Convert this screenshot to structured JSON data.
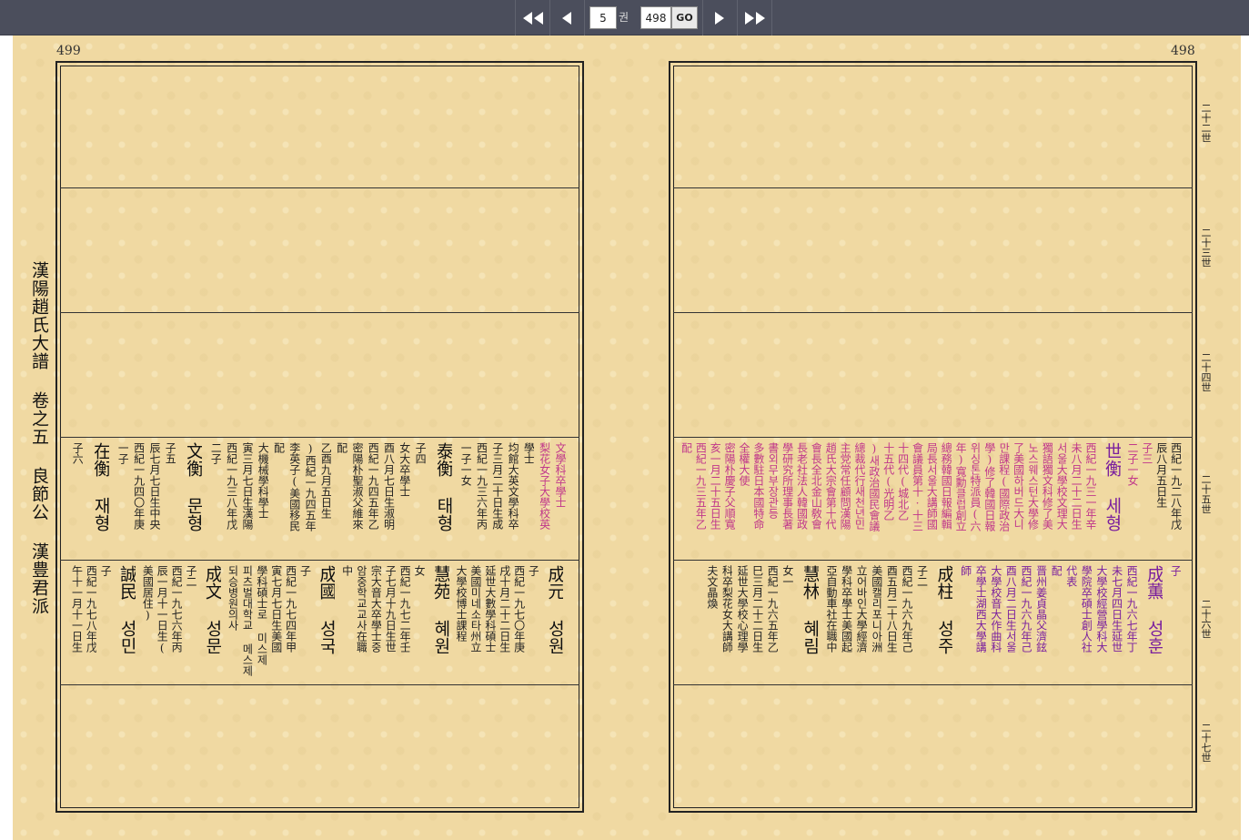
{
  "toolbar": {
    "volume": "5",
    "volume_unit": "권",
    "page": "498",
    "go_label": "GO"
  },
  "pages": {
    "left_number": "499",
    "right_number": "498"
  },
  "side_title": "漢陽趙氏大譜 卷之五 良節公 漢豊君派",
  "generations": [
    "二十二世",
    "二十三世",
    "二十四世",
    "二十五世",
    "二十六世",
    "二十七世"
  ],
  "left_gen25": [
    {
      "t": "子六",
      "c": "#222"
    },
    {
      "t": "在衡 재형",
      "c": "#111",
      "big": true
    },
    {
      "t": "一子",
      "c": "#222"
    },
    {
      "t": "西紀一九四〇年庚",
      "c": "#222"
    },
    {
      "t": "辰七月七日生中央",
      "c": "#222"
    },
    {
      "t": "子五",
      "c": "#222"
    },
    {
      "t": "文衡 문형",
      "c": "#111",
      "big": true
    },
    {
      "t": "二子",
      "c": "#222"
    },
    {
      "t": "西紀一九三八年戊",
      "c": "#222"
    },
    {
      "t": "寅三月七日生漢陽",
      "c": "#222"
    },
    {
      "t": "大機械學科學士",
      "c": "#222"
    },
    {
      "t": "配",
      "c": "#222"
    },
    {
      "t": "李英子(美國移民",
      "c": "#222"
    },
    {
      "t": ")西紀一九四五年",
      "c": "#222"
    },
    {
      "t": "乙酉九月五日生",
      "c": "#222"
    },
    {
      "t": "配",
      "c": "#222"
    },
    {
      "t": "密陽朴聖淑父維來",
      "c": "#222"
    },
    {
      "t": "西紀一九四五年乙",
      "c": "#222"
    },
    {
      "t": "酉八月七日生淑明",
      "c": "#222"
    },
    {
      "t": "女大卒學士",
      "c": "#222"
    },
    {
      "t": "子四",
      "c": "#222"
    },
    {
      "t": "泰衡 태형",
      "c": "#111",
      "big": true
    },
    {
      "t": "一子一女",
      "c": "#222"
    },
    {
      "t": "西紀一九三六年丙",
      "c": "#222"
    },
    {
      "t": "子三月二十日生成",
      "c": "#222"
    },
    {
      "t": "均館大英文學科卒",
      "c": "#222"
    },
    {
      "t": "學士",
      "c": "#222"
    },
    {
      "t": "梨花女子大學校英",
      "c": "#c0378b"
    },
    {
      "t": "文學科卒學士",
      "c": "#c0378b"
    }
  ],
  "left_gen26": [
    {
      "t": "午十一月十一日生",
      "c": "#222"
    },
    {
      "t": "西紀一九七八年戊",
      "c": "#222"
    },
    {
      "t": "子",
      "c": "#222"
    },
    {
      "t": "誠民 성민",
      "c": "#111",
      "big": true
    },
    {
      "t": "美國居住)",
      "c": "#222"
    },
    {
      "t": "辰一月十一日生(",
      "c": "#222"
    },
    {
      "t": "西紀一九七六年丙",
      "c": "#222"
    },
    {
      "t": "子二",
      "c": "#222"
    },
    {
      "t": "成文 성문",
      "c": "#111",
      "big": true
    },
    {
      "t": "되승병원의사",
      "c": "#222"
    },
    {
      "t": "피츠벌대학교 메스제",
      "c": "#222"
    },
    {
      "t": "學科碩士로 미스제",
      "c": "#222"
    },
    {
      "t": "寅七月七日生美國",
      "c": "#222"
    },
    {
      "t": "西紀一九七四年甲",
      "c": "#222"
    },
    {
      "t": "子",
      "c": "#222"
    },
    {
      "t": "成國 성국",
      "c": "#111",
      "big": true
    },
    {
      "t": "中",
      "c": "#222"
    },
    {
      "t": "암중학교교사在職",
      "c": "#222"
    },
    {
      "t": "宗大音大卒學士중",
      "c": "#222"
    },
    {
      "t": "子七月十九日生世",
      "c": "#222"
    },
    {
      "t": "西紀一九七二年壬",
      "c": "#222"
    },
    {
      "t": "女",
      "c": "#222"
    },
    {
      "t": "慧苑 혜원",
      "c": "#111",
      "big": true
    },
    {
      "t": "大學校博士課程",
      "c": "#222"
    },
    {
      "t": "美國미네소타州立",
      "c": "#222"
    },
    {
      "t": "延世大數學科碩士",
      "c": "#222"
    },
    {
      "t": "戌十月二十二日生",
      "c": "#222"
    },
    {
      "t": "西紀一九七〇年庚",
      "c": "#222"
    },
    {
      "t": "子",
      "c": "#222"
    },
    {
      "t": "成元 성원",
      "c": "#111",
      "big": true
    }
  ],
  "right_gen25": [
    {
      "t": "配",
      "c": "#c0378b"
    },
    {
      "t": "西紀一九三五年乙",
      "c": "#c0378b"
    },
    {
      "t": "亥一月二十五日生",
      "c": "#c0378b"
    },
    {
      "t": "密陽朴慶子父順寬",
      "c": "#c0378b"
    },
    {
      "t": "全權大使",
      "c": "#c0378b"
    },
    {
      "t": "多數駐日本國特命",
      "c": "#c0378b"
    },
    {
      "t": "書외무부장관등",
      "c": "#c0378b"
    },
    {
      "t": "學研究所理事長著",
      "c": "#c0378b"
    },
    {
      "t": "長老社法人韓國政",
      "c": "#c0378b"
    },
    {
      "t": "會長全北金山敎會",
      "c": "#c0378b"
    },
    {
      "t": "趙氏大宗會第十代",
      "c": "#c0378b"
    },
    {
      "t": "主党常任顧問漢陽",
      "c": "#c0378b"
    },
    {
      "t": "總裁代行새천년민",
      "c": "#c0378b"
    },
    {
      "t": ")새政治國民會議",
      "c": "#c0378b"
    },
    {
      "t": "十五代(光明乙",
      "c": "#c0378b"
    },
    {
      "t": "十四代(城北乙",
      "c": "#c0378b"
    },
    {
      "t": "會議員第十·十三",
      "c": "#c0378b"
    },
    {
      "t": "局長서울大講師國",
      "c": "#c0378b"
    },
    {
      "t": "總務韓國日報編輯",
      "c": "#c0378b"
    },
    {
      "t": "年)寬勳클럽創立",
      "c": "#c0378b"
    },
    {
      "t": "위싱톤特派員(六",
      "c": "#c0378b"
    },
    {
      "t": "學)修了韓國日報",
      "c": "#c0378b"
    },
    {
      "t": "만課程(國際政治",
      "c": "#c0378b"
    },
    {
      "t": "了美國하버드大니",
      "c": "#c0378b"
    },
    {
      "t": "노스웨스턴大學修",
      "c": "#c0378b"
    },
    {
      "t": "獨語獨文科修了美",
      "c": "#c0378b"
    },
    {
      "t": "서울大學校文理大",
      "c": "#c0378b"
    },
    {
      "t": "未八月二十二日生",
      "c": "#c0378b"
    },
    {
      "t": "西紀一九三一年辛",
      "c": "#c0378b"
    },
    {
      "t": "世衡 세형",
      "c": "#7a1f9e",
      "big": true
    },
    {
      "t": "二子一女",
      "c": "#c0378b"
    },
    {
      "t": "子三",
      "c": "#c0378b"
    },
    {
      "t": "辰八月五日生",
      "c": "#222"
    },
    {
      "t": "西紀一九二八年戊",
      "c": "#222"
    }
  ],
  "right_gen26": [
    {
      "t": "夫文晶煥",
      "c": "#222"
    },
    {
      "t": "科卒梨花女大講師",
      "c": "#222"
    },
    {
      "t": "延世大學校心理學",
      "c": "#222"
    },
    {
      "t": "巳三月二十二日生",
      "c": "#222"
    },
    {
      "t": "西紀一九六五年乙",
      "c": "#222"
    },
    {
      "t": "女一",
      "c": "#222"
    },
    {
      "t": "慧林 혜림",
      "c": "#111",
      "big": true
    },
    {
      "t": "亞自動車社在職中",
      "c": "#222"
    },
    {
      "t": "學科卒學士美國起",
      "c": "#222"
    },
    {
      "t": "立어바인大學經濟",
      "c": "#222"
    },
    {
      "t": "美國캘리포니아洲",
      "c": "#222"
    },
    {
      "t": "酉五月二十八日生",
      "c": "#222"
    },
    {
      "t": "西紀一九六九年己",
      "c": "#222"
    },
    {
      "t": "子二",
      "c": "#222"
    },
    {
      "t": "成柱 성주",
      "c": "#111",
      "big": true
    },
    {
      "t": "師",
      "c": "#7a1f9e"
    },
    {
      "t": "卒學士湖西大學講",
      "c": "#7a1f9e"
    },
    {
      "t": "大學校音大作曲科",
      "c": "#7a1f9e"
    },
    {
      "t": "酉八月二日生서울",
      "c": "#7a1f9e"
    },
    {
      "t": "西紀一九六九年己",
      "c": "#7a1f9e"
    },
    {
      "t": "晋州姜貞晶父濟鉉",
      "c": "#7a1f9e"
    },
    {
      "t": "配",
      "c": "#7a1f9e"
    },
    {
      "t": "代表",
      "c": "#7a1f9e"
    },
    {
      "t": "學院卒碩士創人社",
      "c": "#7a1f9e"
    },
    {
      "t": "大學校經營學科大",
      "c": "#7a1f9e"
    },
    {
      "t": "未七月四日生延世",
      "c": "#7a1f9e"
    },
    {
      "t": "西紀一九六七年丁",
      "c": "#7a1f9e"
    },
    {
      "t": "成薫 성훈",
      "c": "#7a1f9e",
      "big": true
    },
    {
      "t": "子",
      "c": "#7a1f9e"
    }
  ]
}
